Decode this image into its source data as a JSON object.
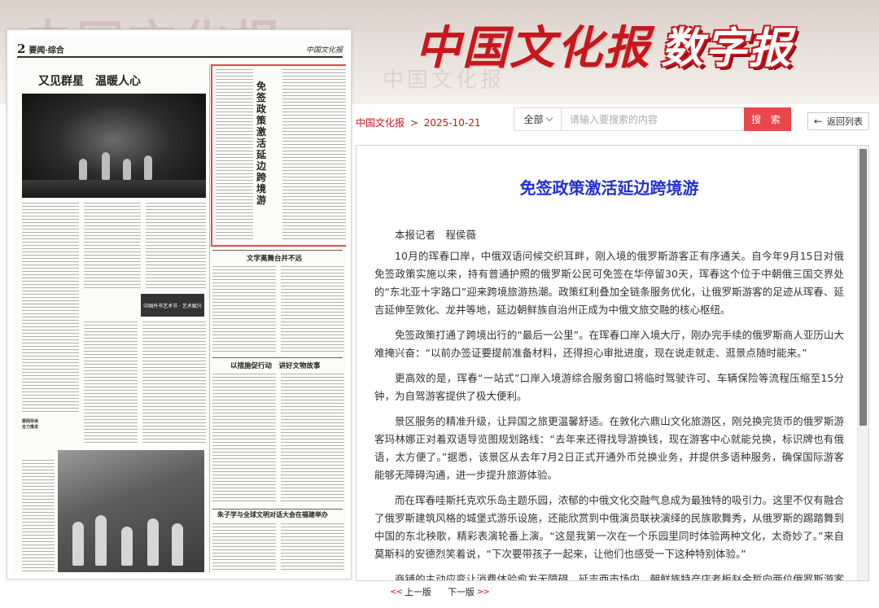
{
  "banner": {
    "newspaper_name": "中国文化报",
    "suffix": "数字报",
    "background_text": "中国文化报"
  },
  "page_thumbnail": {
    "page_number": "2",
    "section": "要闻·综合",
    "masthead": "中国文化报",
    "headlines": {
      "main": "又见群星　温暖人心",
      "boxed": "免签政策激活延边跨境游",
      "second": "文学离舞台并不远",
      "third": "以措施促行动　讲好文物故事",
      "fourth": "朱子学与全球文明对话大会在福建举办"
    },
    "badge_text": "中国丹书艺术节 · 艺术赋兴"
  },
  "breadcrumb": {
    "home": "中国文化报",
    "separator": ">",
    "date": "2025-10-21"
  },
  "search": {
    "scope": "全部",
    "placeholder": "请输入要搜索的内容",
    "button": "搜 索"
  },
  "back_button": {
    "icon": "arrow-left-icon",
    "label": "返回列表"
  },
  "article": {
    "title": "免签政策激活延边跨境游",
    "author": "本报记者　程侯薇",
    "paragraphs": [
      "10月的珲春口岸，中俄双语问候交织耳畔，刚入境的俄罗斯游客正有序通关。自今年9月15日对俄免签政策实施以来，持有普通护照的俄罗斯公民可免签在华停留30天，珲春这个位于中朝俄三国交界处的“东北亚十字路口”迎来跨境旅游热潮。政策红利叠加全链条服务优化，让俄罗斯游客的足迹从珲春、延吉延伸至敦化、龙井等地，延边朝鲜族自治州正成为中俄文旅交融的核心枢纽。",
      "免签政策打通了跨境出行的“最后一公里”。在珲春口岸入境大厅，刚办完手续的俄罗斯商人亚历山大难掩兴奋：“以前办签证要提前准备材料，还得担心审批进度，现在说走就走、逛景点随时能来。”",
      "更高效的是，珲春“一站式”口岸入境游综合服务窗口将临时驾驶许可、车辆保险等流程压缩至15分钟，为自驾游客提供了极大便利。",
      "景区服务的精准升级，让异国之旅更温馨舒适。在敦化六鼎山文化旅游区，刚兑换完货币的俄罗斯游客玛林娜正对着双语导览图规划路线：“去年来还得找导游换钱，现在游客中心就能兑换，标识牌也有俄语，太方便了。”据悉，该景区从去年7月2日正式开通外币兑换业务，并提供多语种服务，确保国际游客能够无障碍沟通，进一步提升旅游体验。",
      "而在珲春哇斯托克欢乐岛主题乐园，浓郁的中俄文化交融气息成为最独特的吸引力。这里不仅有融合了俄罗斯建筑风格的城堡式游乐设施，还能欣赏到中俄演员联袂演绎的民族歌舞秀，从俄罗斯的踢踏舞到中国的东北秧歌，精彩表演轮番上演。“这是我第一次在一个乐园里同时体验两种文化，太奇妙了。”来自莫斯科的安德烈笑着说，“下次要带孩子一起来，让他们也感受一下这种特别体验。”",
      "商铺的主动应变让消费体验愈发无障碍。延吉西市场内，朝鲜族特产店老板赵金哲向两位俄罗斯游客介绍明太鱼干的吃法：“这个可以泡软了凉拌，也能烤着吃，保质期6个月，带回去给家人当伴手礼正好。”"
    ]
  },
  "pager": {
    "prev": "上一版",
    "next": "下一版",
    "prev_arrows": "<<",
    "next_arrows": ">>"
  },
  "colors": {
    "brand_red": "#c8161d",
    "search_button": "#e8474b",
    "article_title": "#2430d4",
    "highlight_box": "#e84848"
  }
}
